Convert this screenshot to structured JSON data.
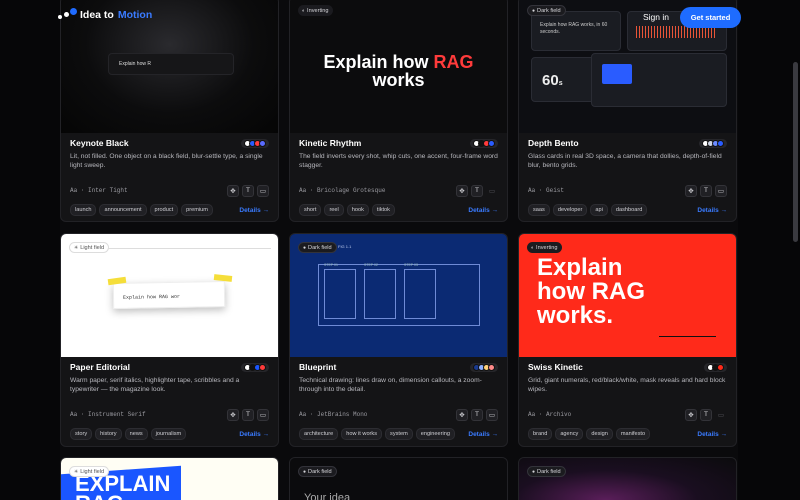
{
  "nav": {
    "brand_a": "Idea to",
    "brand_b": "Motion",
    "signin": "Sign in",
    "cta": "Get started"
  },
  "accent": "#1e6cff",
  "cards": [
    {
      "title": "Keynote Black",
      "desc": "Lit, not filled. One object on a black field, blur-settle type, a single light sweep.",
      "font": "Aa · Inter Tight",
      "tags": [
        "launch",
        "announcement",
        "product",
        "premium"
      ],
      "details": "Details →",
      "preview_text": "Explain how R",
      "swatches": [
        "#ffffff",
        "#2a5cff",
        "#ff3b3b",
        "#5a6bff"
      ]
    },
    {
      "title": "Kinetic Rhythm",
      "desc": "The field inverts every shot, whip cuts, one accent, four-frame word stagger.",
      "font": "Aa · Bricolage Grotesque",
      "tags": [
        "short",
        "reel",
        "hook",
        "tiktok"
      ],
      "details": "Details →",
      "badge": "Inverting",
      "preview_a": "Explain how ",
      "preview_b": "RAG",
      "preview_c": "works",
      "swatches": [
        "#ffffff",
        "#111111",
        "#ff3b3b",
        "#2a5cff"
      ]
    },
    {
      "title": "Depth Bento",
      "desc": "Glass cards in real 3D space, a camera that dollies, depth-of-field blur, bento grids.",
      "font": "Aa · Geist",
      "tags": [
        "saas",
        "developer",
        "api",
        "dashboard"
      ],
      "details": "Details →",
      "badge": "Dark field",
      "preview_text": "Explain how RAG works, in 60 seconds.",
      "big_number": "60",
      "big_unit": "s",
      "swatches": [
        "#ffffff",
        "#cfd6e6",
        "#6b8bff",
        "#2a5cff"
      ]
    },
    {
      "title": "Paper Editorial",
      "desc": "Warm paper, serif italics, highlighter tape, scribbles and a typewriter — the magazine look.",
      "font": "Aa · Instrument Serif",
      "tags": [
        "story",
        "history",
        "news",
        "journalism"
      ],
      "details": "Details →",
      "badge": "Light field",
      "preview_text": "Explain how RAG wor",
      "swatches": [
        "#ffffff",
        "#111111",
        "#1a56ff",
        "#ff3b3b"
      ]
    },
    {
      "title": "Blueprint",
      "desc": "Technical drawing: lines draw on, dimension callouts, a zoom-through into the detail.",
      "font": "Aa · JetBrains Mono",
      "tags": [
        "architecture",
        "how it works",
        "system",
        "engineering"
      ],
      "details": "Details →",
      "badge": "Dark field",
      "preview_head": "FIG 1.1",
      "panel_labels": [
        "STEP 01",
        "STEP 02",
        "STEP 03"
      ],
      "swatches": [
        "#1a3a8f",
        "#8fb0ff",
        "#ffd27a",
        "#ff8a8a"
      ]
    },
    {
      "title": "Swiss Kinetic",
      "desc": "Grid, giant numerals, red/black/white, mask reveals and hard block wipes.",
      "font": "Aa · Archivo",
      "tags": [
        "brand",
        "agency",
        "design",
        "manifesto"
      ],
      "details": "Details →",
      "badge": "Inverting",
      "preview_text": "Explain how RAG works.",
      "swatches": [
        "#ffffff",
        "#111111",
        "#ff2a1a"
      ]
    },
    {
      "badge": "Light field",
      "preview_text": "EXPLAIN RAG"
    },
    {
      "badge": "Dark field",
      "preview_text": "Your idea"
    },
    {
      "badge": "Dark field"
    }
  ],
  "icons": [
    "motion-icon",
    "type-icon",
    "video-icon"
  ]
}
